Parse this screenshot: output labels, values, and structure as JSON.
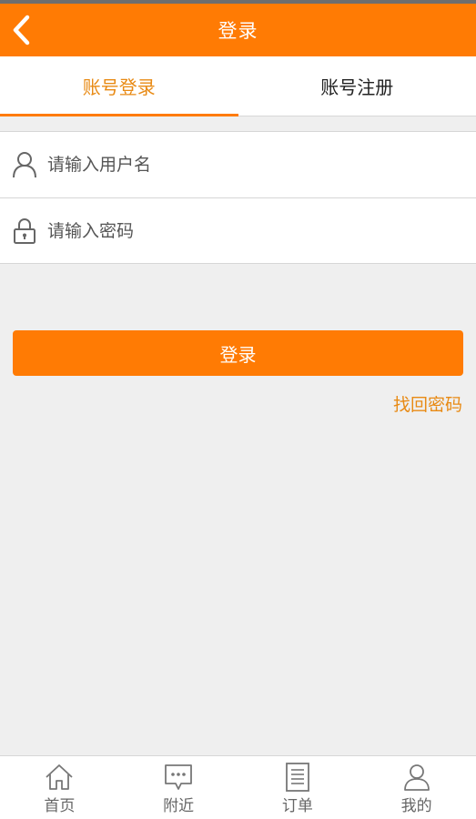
{
  "header": {
    "title": "登录",
    "back_icon": "chevron-left-icon"
  },
  "tabs": [
    {
      "label": "账号登录",
      "active": true
    },
    {
      "label": "账号注册",
      "active": false
    }
  ],
  "form": {
    "username": {
      "placeholder": "请输入用户名",
      "value": "",
      "icon": "user-icon"
    },
    "password": {
      "placeholder": "请输入密码",
      "value": "",
      "icon": "lock-icon"
    }
  },
  "actions": {
    "login_label": "登录",
    "forgot_label": "找回密码"
  },
  "bottom_nav": [
    {
      "label": "首页",
      "icon": "home-icon"
    },
    {
      "label": "附近",
      "icon": "chat-icon"
    },
    {
      "label": "订单",
      "icon": "document-icon"
    },
    {
      "label": "我的",
      "icon": "profile-icon"
    }
  ],
  "colors": {
    "accent": "#ff7b04",
    "accent_text": "#e88a14",
    "background": "#efefef"
  }
}
